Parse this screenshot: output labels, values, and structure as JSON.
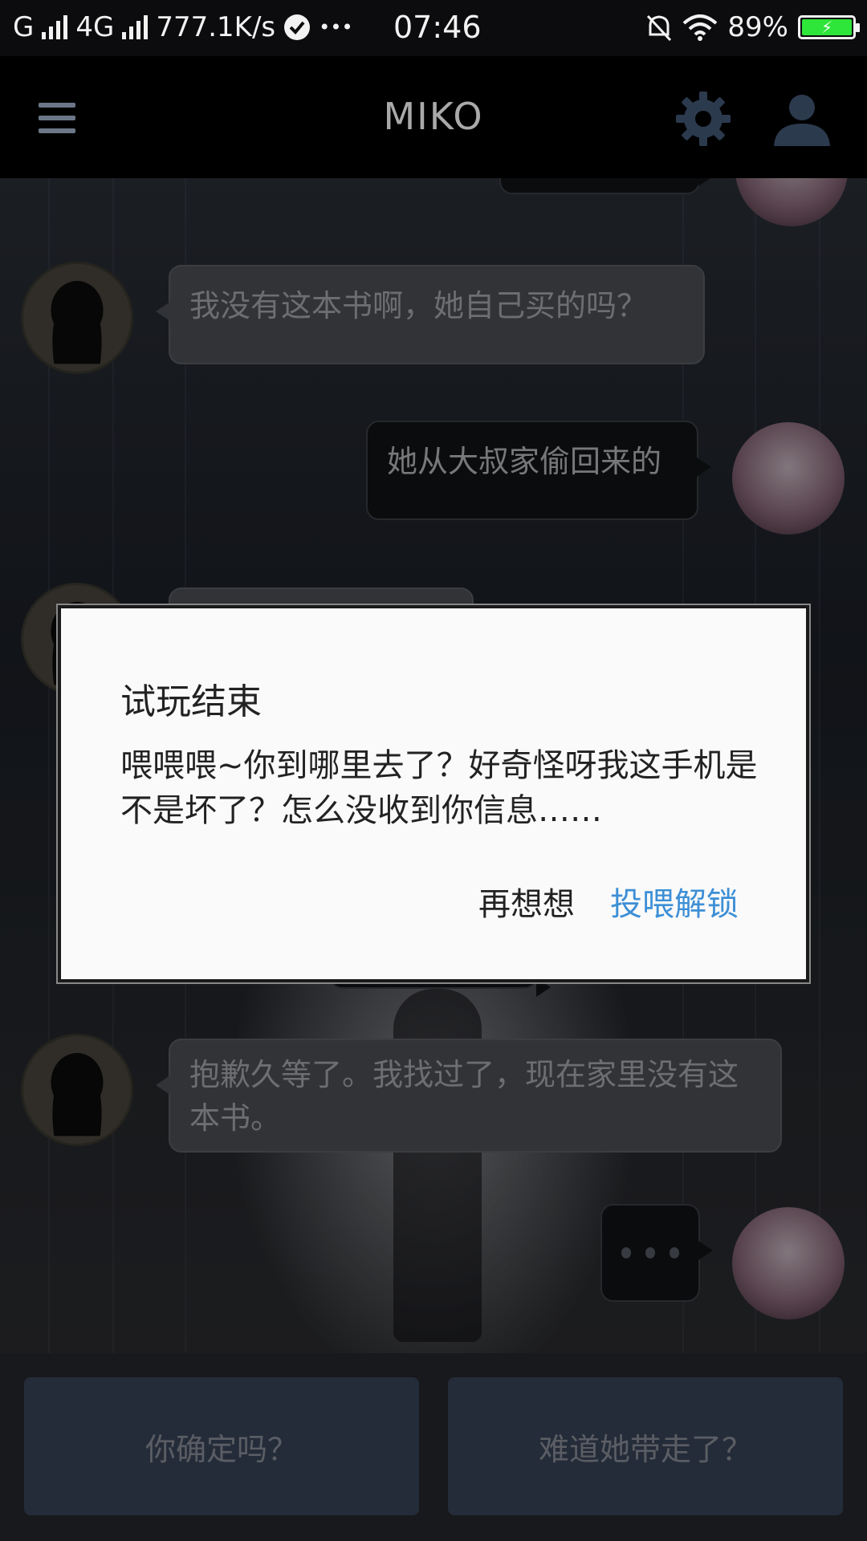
{
  "status_bar": {
    "carrier1": "G",
    "carrier2": "4G",
    "speed": "777.1K/s",
    "dots": "•••",
    "time": "07:46",
    "battery": "89%"
  },
  "header": {
    "title": "MIKO"
  },
  "messages": [
    {
      "side": "left",
      "text": "我没有这本书啊，她自己买的吗？"
    },
    {
      "side": "right",
      "text": "她从大叔家偷回来的"
    },
    {
      "side": "left",
      "text": "抱歉久等了。我找过了，现在家里没有这本书。"
    }
  ],
  "dialog": {
    "title": "试玩结束",
    "body": "喂喂喂~你到哪里去了？好奇怪呀我这手机是不是坏了？怎么没收到你信息……",
    "cancel": "再想想",
    "confirm": "投喂解锁"
  },
  "choices": [
    "你确定吗？",
    "难道她带走了？"
  ],
  "colors": {
    "accent": "#3d8fd6",
    "battery": "#2ee53a",
    "choice_bg": "#3a4458"
  }
}
